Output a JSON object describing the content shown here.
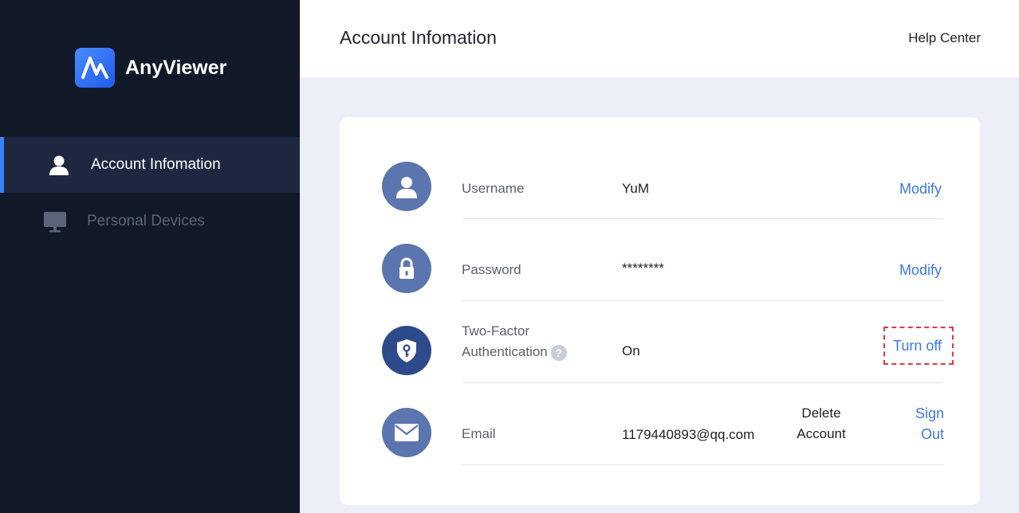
{
  "app": {
    "name": "AnyViewer"
  },
  "sidebar": {
    "items": [
      {
        "label": "Account Infomation",
        "active": true,
        "icon": "user-icon"
      },
      {
        "label": "Personal Devices",
        "active": false,
        "icon": "monitor-icon"
      }
    ]
  },
  "header": {
    "title": "Account Infomation",
    "help": "Help Center"
  },
  "account": {
    "username": {
      "label": "Username",
      "value": "YuM",
      "action": "Modify"
    },
    "password": {
      "label": "Password",
      "value": "********",
      "action": "Modify"
    },
    "two_factor": {
      "label_line1": "Two-Factor",
      "label_line2": "Authentication",
      "help_glyph": "?",
      "value": "On",
      "action": "Turn off"
    },
    "email": {
      "label": "Email",
      "value": "1179440893@qq.com",
      "delete_line1": "Delete",
      "delete_line2": "Account",
      "signout_line1": "Sign",
      "signout_line2": "Out"
    }
  },
  "colors": {
    "accent": "#3b78e7",
    "sidebar_bg": "#111827",
    "highlight": "#e03a3a"
  }
}
